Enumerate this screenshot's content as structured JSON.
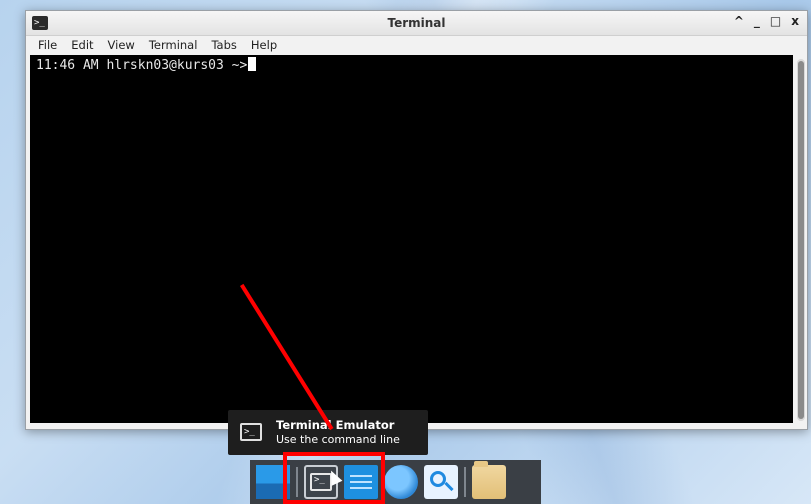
{
  "window": {
    "title": "Terminal",
    "icon": "terminal-icon",
    "controls": {
      "shade": "^",
      "minimize": "_",
      "maximize": "□",
      "close": "x"
    }
  },
  "menu": [
    "File",
    "Edit",
    "View",
    "Terminal",
    "Tabs",
    "Help"
  ],
  "terminal": {
    "prompt": "11:46 AM hlrskn03@kurs03 ~>"
  },
  "tooltip": {
    "title": "Terminal Emulator",
    "description": "Use the command line"
  },
  "dock": {
    "items": [
      "applications-icon",
      "terminal-icon",
      "documents-icon",
      "web-browser-icon",
      "search-icon",
      "file-manager-icon"
    ]
  },
  "annotation_color": "#ff0000"
}
